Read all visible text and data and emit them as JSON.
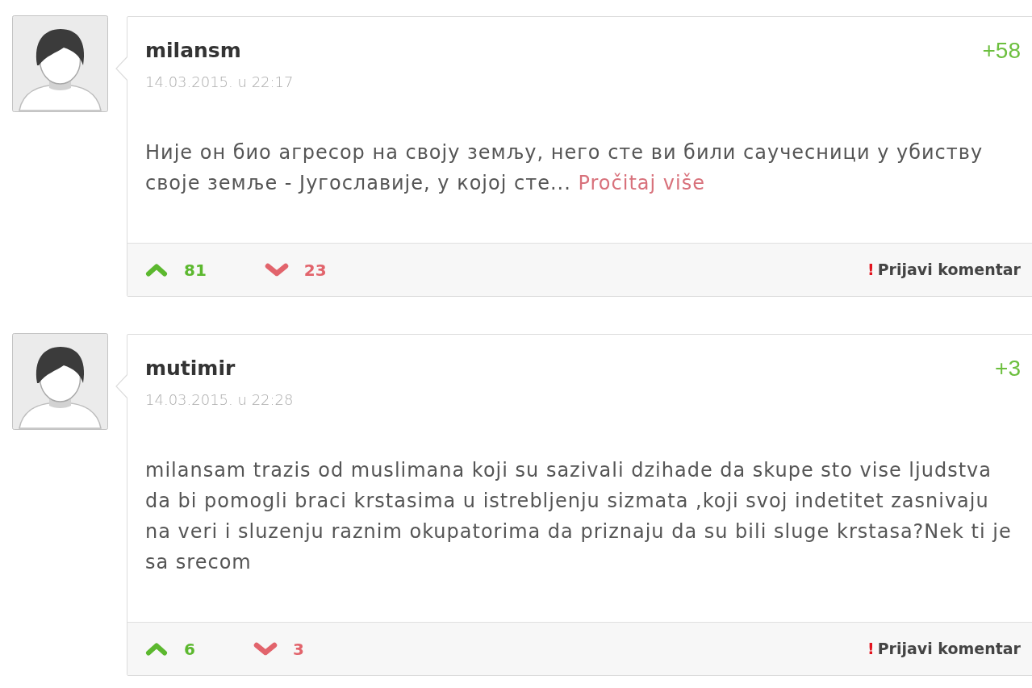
{
  "comments": [
    {
      "username": "milansm",
      "date": "14.03.2015. u 22:17",
      "score": "+58",
      "body": "Није он био агресор на своју земљу, него сте ви били саучесници у убиству своје земље - Југославије, у којој сте...",
      "read_more": "Pročitaj više",
      "upvotes": "81",
      "downvotes": "23",
      "report": {
        "mark": "!",
        "label": "Prijavi komentar"
      }
    },
    {
      "username": "mutimir",
      "date": "14.03.2015. u 22:28",
      "score": "+3",
      "body": "milansam trazis od muslimana koji su sazivali dzihade da skupe sto vise ljudstva da bi pomogli braci krstasima u istrebljenju sizmata ,koji svoj indetitet zasnivaju na veri i sluzenju raznim okupatorima da priznaju da su bili sluge krstasa?Nek ti je sa srecom",
      "upvotes": "6",
      "downvotes": "3",
      "report": {
        "mark": "!",
        "label": "Prijavi komentar"
      }
    }
  ]
}
